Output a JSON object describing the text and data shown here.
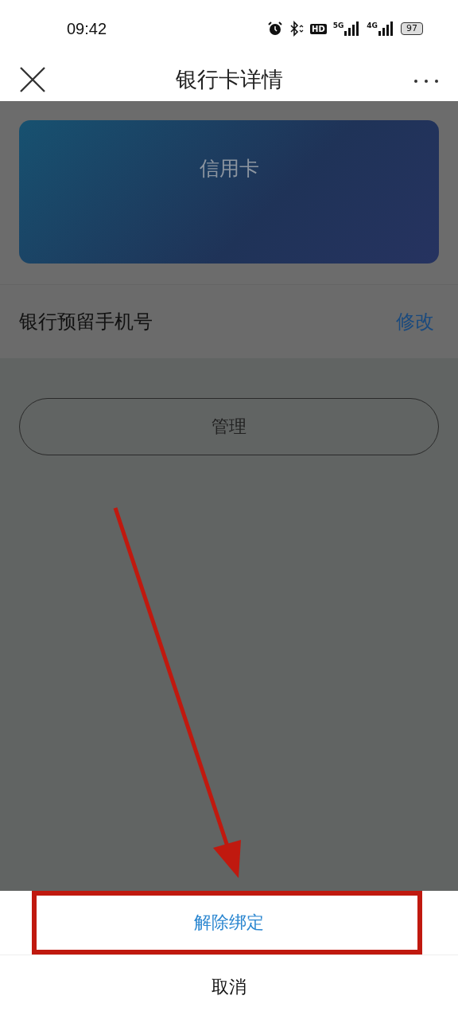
{
  "status_bar": {
    "time": "09:42",
    "hd_label": "HD",
    "networks": [
      {
        "label": "5G"
      },
      {
        "label": "4G"
      }
    ],
    "battery": "97"
  },
  "nav": {
    "title": "银行卡详情"
  },
  "card": {
    "label": "信用卡"
  },
  "phone_row": {
    "label": "银行预留手机号",
    "action": "修改"
  },
  "manage_button": "管理",
  "sheet": {
    "actions": [
      {
        "label": "解除绑定",
        "kind": "primary",
        "highlighted": true
      },
      {
        "label": "取消",
        "kind": "cancel",
        "highlighted": false
      }
    ]
  }
}
